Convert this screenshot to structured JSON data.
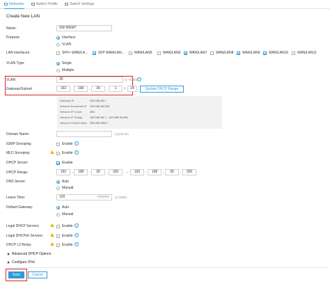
{
  "tabs": [
    {
      "label": "Networks",
      "icon": "network-icon",
      "active": true
    },
    {
      "label": "Switch Profile",
      "icon": "profile-icon",
      "active": false
    },
    {
      "label": "Switch Settings",
      "icon": "settings-icon",
      "active": false
    }
  ],
  "title": "Create New LAN",
  "name": {
    "label": "Name:",
    "value": "SW MGMT"
  },
  "purpose": {
    "label": "Purpose:",
    "options": [
      "Interface",
      "VLAN"
    ],
    "selected": "Interface"
  },
  "lan_interfaces": {
    "label": "LAN Interfaces:",
    "items": [
      {
        "label": "SFP+ WAN/LA...",
        "checked": false
      },
      {
        "label": "SFP WAN/LAN...",
        "checked": true
      },
      {
        "label": "WAN/LAN5",
        "checked": false
      },
      {
        "label": "WAN/LAN6",
        "checked": false
      },
      {
        "label": "WAN/LAN7",
        "checked": true
      },
      {
        "label": "WAN/LAN8",
        "checked": false
      },
      {
        "label": "WAN/LAN9",
        "checked": true
      },
      {
        "label": "WAN/LAN10",
        "checked": true
      },
      {
        "label": "WAN/LAN11",
        "checked": false
      }
    ]
  },
  "vlan_type": {
    "label": "VLAN Type:",
    "options": [
      "Single",
      "Multiple"
    ],
    "selected": "Single"
  },
  "vlan": {
    "label": "VLAN",
    "value": "30",
    "hint": "(1~4090)"
  },
  "gateway": {
    "label": "Gateway/Subnet",
    "octets": [
      "192",
      "168",
      "30",
      "1"
    ],
    "mask": "24",
    "update_button": "Update DHCP Range"
  },
  "subnet_info": [
    {
      "key": "Gateway IP",
      "value": "192.168.30.1"
    },
    {
      "key": "Network Broadcast IP",
      "value": "192.168.30.255"
    },
    {
      "key": "Network IP Count",
      "value": "254"
    },
    {
      "key": "Network IP Range",
      "value": "192.168.30.1 - 192.168.30.254"
    },
    {
      "key": "Network Subnet Mask",
      "value": "255.255.255.0"
    }
  ],
  "domain_name": {
    "label": "Domain Name:",
    "value": "",
    "hint": "(Optional)"
  },
  "igmp": {
    "label": "IGMP Snooping:",
    "option": "Enable",
    "checked": false
  },
  "mld": {
    "label": "MLD Snooping:",
    "option": "Enable",
    "checked": false
  },
  "dhcp_server": {
    "label": "DHCP Server:",
    "option": "Enable",
    "checked": true
  },
  "dhcp_range": {
    "label": "DHCP Range:",
    "start": [
      "192",
      "168",
      "30",
      "100"
    ],
    "end": [
      "192",
      "168",
      "30",
      "200"
    ],
    "separator": "-"
  },
  "dns_server": {
    "label": "DNS Server:",
    "options": [
      "Auto",
      "Manual"
    ],
    "selected": "Auto"
  },
  "lease_time": {
    "label": "Lease Time:",
    "value": "120",
    "unit": "minutes",
    "hint": "(2-2880)"
  },
  "default_gateway": {
    "label": "Default Gateway:",
    "options": [
      "Auto",
      "Manual"
    ],
    "selected": "Auto"
  },
  "legal_dhcp": {
    "label": "Legal DHCP Servers:",
    "option": "Enable",
    "checked": false
  },
  "legal_dhcpv6": {
    "label": "Legal DHCPv6 Servers:",
    "option": "Enable",
    "checked": false
  },
  "dhcp_l2_relay": {
    "label": "DHCP L2 Relay:",
    "option": "Enable",
    "checked": false
  },
  "advanced_dhcp": {
    "label": "Advanced DHCP Options"
  },
  "configure_ipv6": {
    "label": "Configure IPv6"
  },
  "buttons": {
    "save": "Save",
    "cancel": "Cancel"
  },
  "colors": {
    "accent": "#2f9ad8",
    "highlight": "#e02020",
    "warning": "#f0b400"
  }
}
